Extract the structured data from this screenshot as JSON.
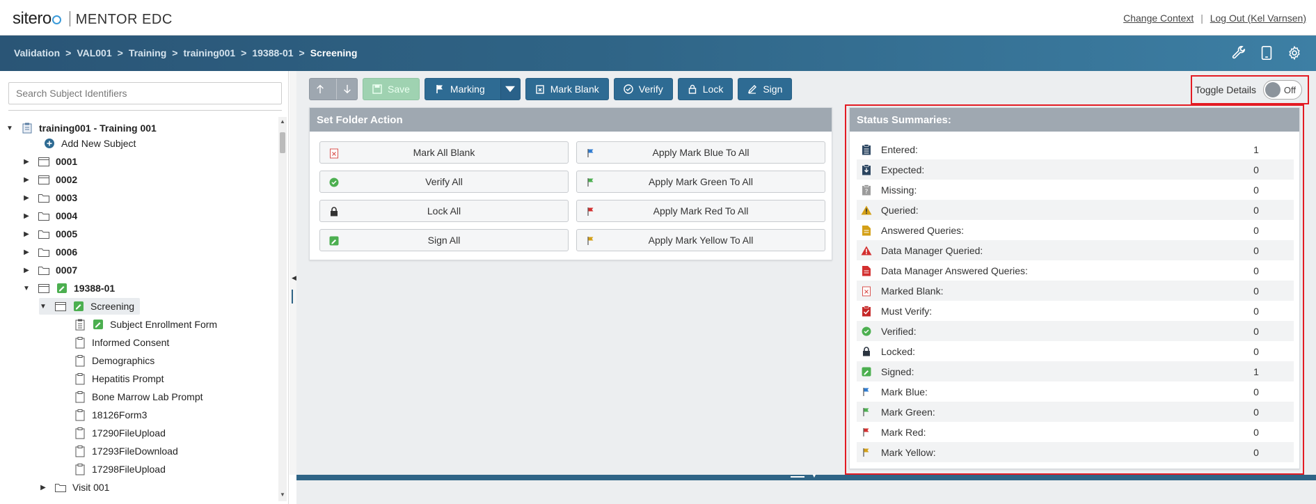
{
  "brand": {
    "name_part1": "sitero",
    "name_part2": "MENTOR EDC"
  },
  "header": {
    "change_context": "Change Context",
    "separator": "|",
    "logout": "Log Out (Kel Varnsen)"
  },
  "breadcrumb": {
    "items": [
      "Validation",
      "VAL001",
      "Training",
      "training001",
      "19388-01"
    ],
    "current": "Screening",
    "separator": ">"
  },
  "search": {
    "placeholder": "Search Subject Identifiers"
  },
  "tree": {
    "root": "training001 - Training 001",
    "add_subject": "Add New Subject",
    "subjects": [
      "0001",
      "0002",
      "0003",
      "0004",
      "0005",
      "0006",
      "0007"
    ],
    "expanded_subject": "19388-01",
    "folder": "Screening",
    "forms": [
      "Subject Enrollment Form",
      "Informed Consent",
      "Demographics",
      "Hepatitis Prompt",
      "Bone Marrow Lab Prompt",
      "18126Form3",
      "17290FileUpload",
      "17293FileDownload",
      "17298FileUpload"
    ],
    "next_folder": "Visit 001"
  },
  "toolbar": {
    "save": "Save",
    "marking": "Marking",
    "mark_all_blank": "Mark Blank",
    "verify": "Verify",
    "lock": "Lock",
    "sign": "Sign"
  },
  "toggle": {
    "label": "Toggle Details",
    "state": "Off"
  },
  "folder_action": {
    "title": "Set Folder Action",
    "buttons": [
      "Mark All Blank",
      "Apply Mark Blue To All",
      "Verify All",
      "Apply Mark Green To All",
      "Lock All",
      "Apply Mark Red To All",
      "Sign All",
      "Apply Mark Yellow To All"
    ]
  },
  "status": {
    "title": "Status Summaries:",
    "rows": [
      {
        "label": "Entered:",
        "value": "1"
      },
      {
        "label": "Expected:",
        "value": "0"
      },
      {
        "label": "Missing:",
        "value": "0"
      },
      {
        "label": "Queried:",
        "value": "0"
      },
      {
        "label": "Answered Queries:",
        "value": "0"
      },
      {
        "label": "Data Manager Queried:",
        "value": "0"
      },
      {
        "label": "Data Manager Answered Queries:",
        "value": "0"
      },
      {
        "label": "Marked Blank:",
        "value": "0"
      },
      {
        "label": "Must Verify:",
        "value": "0"
      },
      {
        "label": "Verified:",
        "value": "0"
      },
      {
        "label": "Locked:",
        "value": "0"
      },
      {
        "label": "Signed:",
        "value": "1"
      },
      {
        "label": "Mark Blue:",
        "value": "0"
      },
      {
        "label": "Mark Green:",
        "value": "0"
      },
      {
        "label": "Mark Red:",
        "value": "0"
      },
      {
        "label": "Mark Yellow:",
        "value": "0"
      }
    ]
  },
  "colors": {
    "primary": "#2e6b93",
    "header_band": "#2f6486",
    "highlight": "#e31b23",
    "flag_blue": "#2e7bd0",
    "flag_green": "#4caf50",
    "flag_red": "#d32f2f",
    "flag_yellow": "#d4a017"
  }
}
